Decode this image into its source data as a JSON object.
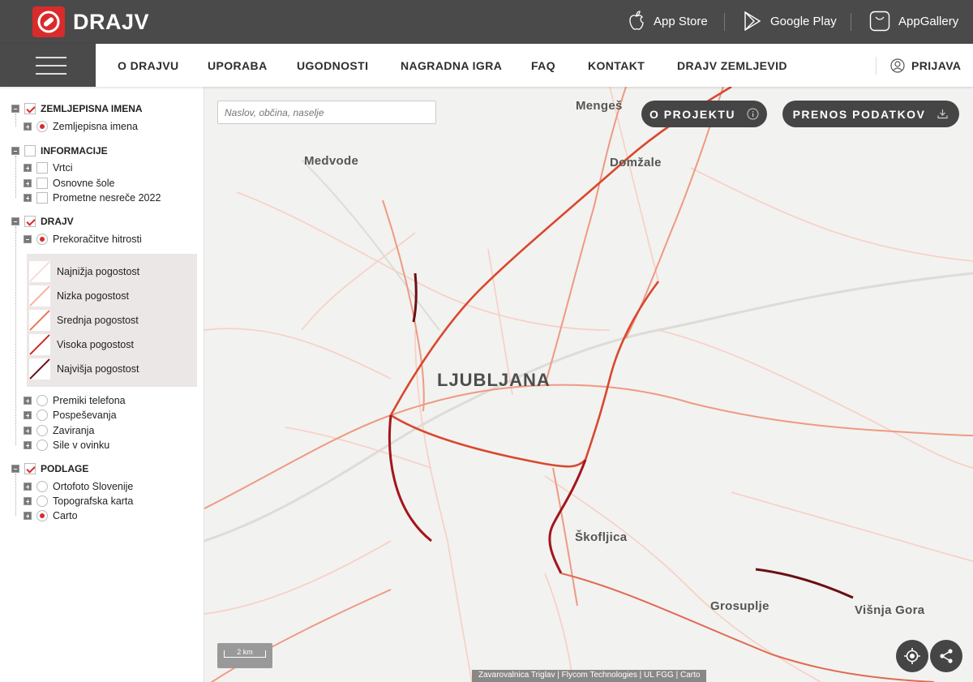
{
  "header": {
    "brand": "DRAJV",
    "stores": [
      {
        "label": "App Store",
        "icon": "apple-icon"
      },
      {
        "label": "Google Play",
        "icon": "google-play-icon"
      },
      {
        "label": "AppGallery",
        "icon": "appgallery-icon"
      }
    ]
  },
  "nav": {
    "items": [
      "O DRAJVU",
      "UPORABA",
      "UGODNOSTI",
      "NAGRADNA IGRA",
      "FAQ",
      "KONTAKT",
      "DRAJV ZEMLJEVID"
    ],
    "login": "PRIJAVA"
  },
  "sidebar": {
    "groups": [
      {
        "label": "ZEMLJEPISNA IMENA",
        "checked": true,
        "items": [
          {
            "label": "Zemljepisna imena",
            "selected": true
          }
        ]
      },
      {
        "label": "INFORMACIJE",
        "checked": false,
        "items": [
          {
            "label": "Vrtci"
          },
          {
            "label": "Osnovne šole"
          },
          {
            "label": "Prometne nesreče 2022"
          }
        ]
      },
      {
        "label": "DRAJV",
        "checked": true,
        "items": [
          {
            "label": "Prekoračitve hitrosti",
            "selected": true
          },
          {
            "label": "Premiki telefona"
          },
          {
            "label": "Pospeševanja"
          },
          {
            "label": "Zaviranja"
          },
          {
            "label": "Sile v ovinku"
          }
        ]
      },
      {
        "label": "PODLAGE",
        "checked": true,
        "items": [
          {
            "label": "Ortofoto Slovenije"
          },
          {
            "label": "Topografska karta"
          },
          {
            "label": "Carto",
            "selected": true
          }
        ]
      }
    ],
    "legend": [
      {
        "label": "Najnižja pogostost",
        "color": "#f6dcd6"
      },
      {
        "label": "Nizka pogostost",
        "color": "#f4b39e"
      },
      {
        "label": "Srednja pogostost",
        "color": "#e8775c"
      },
      {
        "label": "Visoka pogostost",
        "color": "#c92a2a"
      },
      {
        "label": "Najvišja pogostost",
        "color": "#6b0f14"
      }
    ]
  },
  "map": {
    "search_placeholder": "Naslov, občina, naselje",
    "project_button": "O PROJEKTU",
    "download_button": "PRENOS PODATKOV",
    "places": [
      "Mengeš",
      "Medvode",
      "Domžale",
      "LJUBLJANA",
      "Škofljica",
      "Grosuplje",
      "Višnja Gora"
    ],
    "scale": "2 km",
    "attribution": "Zavarovalnica Triglav | Flycom Technologies | UL FGG | Carto"
  }
}
